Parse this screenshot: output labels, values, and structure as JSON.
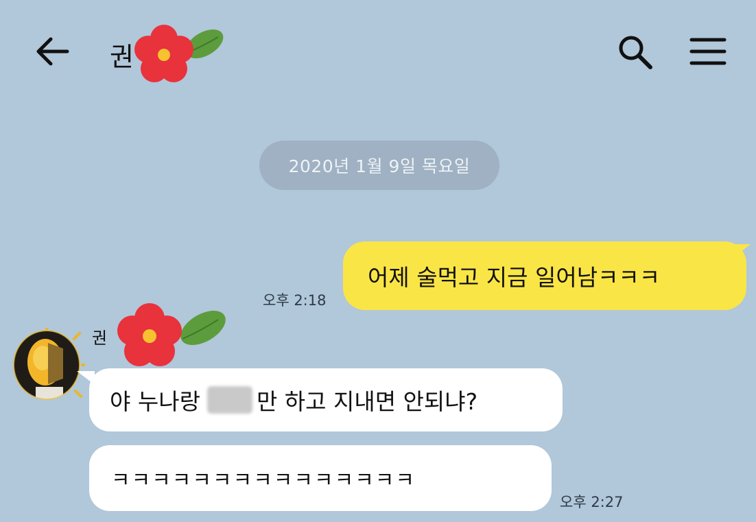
{
  "colors": {
    "background": "#b1c7da",
    "my_bubble": "#fae546",
    "their_bubble": "#ffffff",
    "date_pill": "#9fb1c2"
  },
  "header": {
    "back_icon": "arrow-left-icon",
    "title": "권",
    "title_emoji": "red-flower-emoji",
    "search_icon": "search-icon",
    "menu_icon": "hamburger-menu-icon"
  },
  "date_divider": "2020년 1월 9일 목요일",
  "messages": [
    {
      "from": "me",
      "text": "어제 술먹고 지금 일어남ㅋㅋㅋ",
      "time": "오후 2:18"
    },
    {
      "from": "them",
      "sender": "권",
      "text_before_blur": "야 누나랑",
      "text_after_blur": "만 하고 지내면 안되냐?"
    },
    {
      "from": "them",
      "text": "ㅋㅋㅋㅋㅋㅋㅋㅋㅋㅋㅋㅋㅋㅋㅋ",
      "time": "오후 2:27"
    }
  ]
}
